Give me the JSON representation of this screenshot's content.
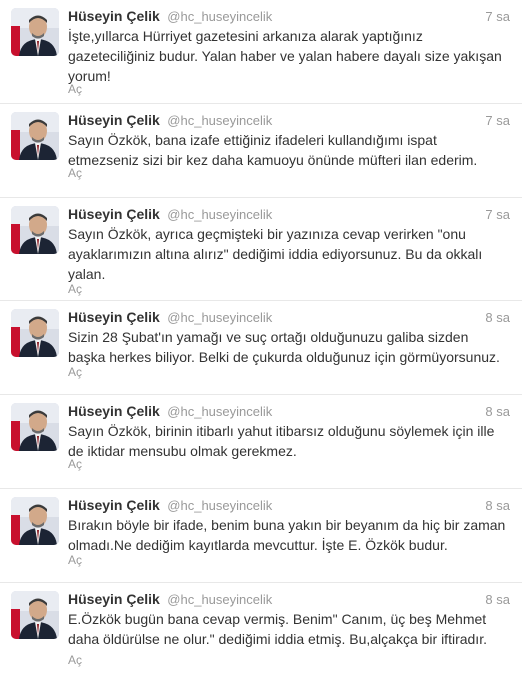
{
  "tweets": [
    {
      "name": "Hüseyin Çelik",
      "handle": "@hc_huseyincelik",
      "time": "7 sa",
      "text": "İşte,yıllarca Hürriyet gazetesini arkanıza alarak yaptığınız gazeteciliğiniz budur. Yalan haber ve yalan habere dayalı size yakışan yorum!",
      "action": "Aç"
    },
    {
      "name": "Hüseyin Çelik",
      "handle": "@hc_huseyincelik",
      "time": "7 sa",
      "text": "Sayın Özkök, bana izafe ettiğiniz ifadeleri kullandığımı ispat etmezseniz sizi bir kez daha kamuoyu önünde müfteri ilan ederim.",
      "action": "Aç"
    },
    {
      "name": "Hüseyin Çelik",
      "handle": "@hc_huseyincelik",
      "time": "7 sa",
      "text": "Sayın Özkök, ayrıca geçmişteki bir yazınıza cevap verirken \"onu ayaklarımızın altına alırız\" dediğimi iddia ediyorsunuz. Bu da okkalı yalan.",
      "action": "Aç"
    },
    {
      "name": "Hüseyin Çelik",
      "handle": "@hc_huseyincelik",
      "time": "8 sa",
      "text": "Sizin 28 Şubat'ın yamağı ve suç ortağı olduğunuzu galiba sizden başka herkes biliyor. Belki de çukurda olduğunuz için görmüyorsunuz.",
      "action": "Aç"
    },
    {
      "name": "Hüseyin Çelik",
      "handle": "@hc_huseyincelik",
      "time": "8 sa",
      "text": "Sayın Özkök, birinin itibarlı yahut itibarsız olduğunu söylemek için ille de iktidar mensubu olmak gerekmez.",
      "action": "Aç"
    },
    {
      "name": "Hüseyin Çelik",
      "handle": "@hc_huseyincelik",
      "time": "8 sa",
      "text": "Bırakın böyle bir ifade, benim buna yakın bir beyanım da hiç bir zaman olmadı.Ne dediğim kayıtlarda mevcuttur. İşte E. Özkök budur.",
      "action": "Aç"
    },
    {
      "name": "Hüseyin Çelik",
      "handle": "@hc_huseyincelik",
      "time": "8 sa",
      "text": "E.Özkök bugün bana cevap vermiş. Benim\" Canım, üç beş Mehmet daha öldürülse ne olur.\" dediğimi iddia etmiş. Bu,alçakça bir iftiradır.",
      "action": "Aç"
    }
  ]
}
